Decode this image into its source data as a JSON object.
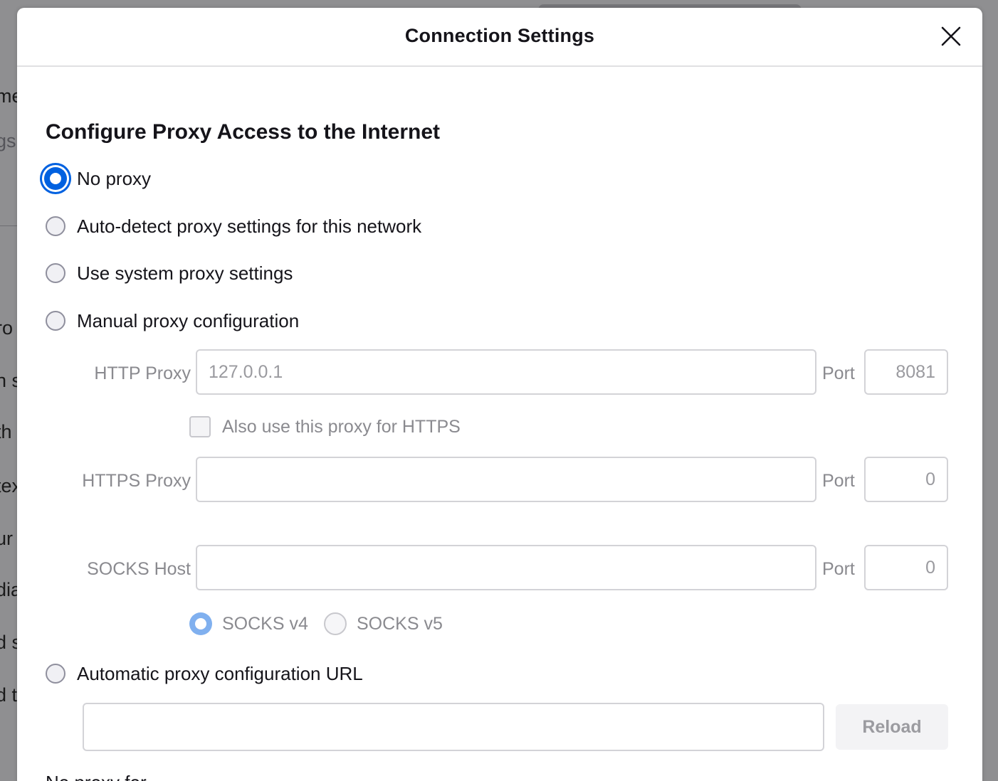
{
  "background": {
    "fragments": [
      "me",
      "gs",
      "ro",
      "n s",
      "th",
      "tex",
      "ur",
      "dia",
      "d s",
      "d t"
    ]
  },
  "dialog": {
    "title": "Connection Settings",
    "close_icon": "close-icon",
    "section_title": "Configure Proxy Access to the Internet",
    "proxy_options": {
      "no_proxy": "No proxy",
      "auto_detect": "Auto-detect proxy settings for this network",
      "system": "Use system proxy settings",
      "manual": "Manual proxy configuration",
      "auto_url": "Automatic proxy configuration URL"
    },
    "selected_option": "no_proxy",
    "manual": {
      "http_label": "HTTP Proxy",
      "http_value": "127.0.0.1",
      "http_port_label": "Port",
      "http_port_value": "8081",
      "also_https_label": "Also use this proxy for HTTPS",
      "also_https_checked": false,
      "https_label": "HTTPS Proxy",
      "https_value": "",
      "https_port_label": "Port",
      "https_port_value": "0",
      "socks_label": "SOCKS Host",
      "socks_value": "",
      "socks_port_label": "Port",
      "socks_port_value": "0",
      "socks_v4_label": "SOCKS v4",
      "socks_v5_label": "SOCKS v5",
      "socks_selected": "v4"
    },
    "auto_url": {
      "value": "",
      "reload_label": "Reload"
    },
    "cut_off_text": "No proxy for"
  },
  "colors": {
    "accent": "#0061e0",
    "accent_disabled": "#80b0ef",
    "overlay": "#8f8f91"
  }
}
